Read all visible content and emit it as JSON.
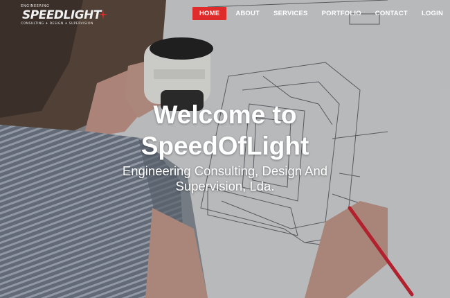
{
  "logo": {
    "top_text": "ENGINEERING",
    "main_text": "SPEEDLIGHT",
    "sub_text": "CONSULTING ✦ DESIGN ✦ SUPERVISION"
  },
  "nav": {
    "items": [
      {
        "label": "HOME"
      },
      {
        "label": "ABOUT"
      },
      {
        "label": "SERVICES"
      },
      {
        "label": "PORTFOLIO"
      },
      {
        "label": "CONTACT"
      },
      {
        "label": "LOGIN"
      }
    ],
    "active_index": 0
  },
  "hero": {
    "title_line1": "Welcome to",
    "title_line2": "SpeedOfLight",
    "subtitle_line1": "Engineering Consulting, Design And",
    "subtitle_line2": "Supervision, Lda."
  },
  "colors": {
    "accent": "#e02b2b",
    "text": "#ffffff"
  },
  "icons": {
    "language": "portugal-flag-icon"
  }
}
